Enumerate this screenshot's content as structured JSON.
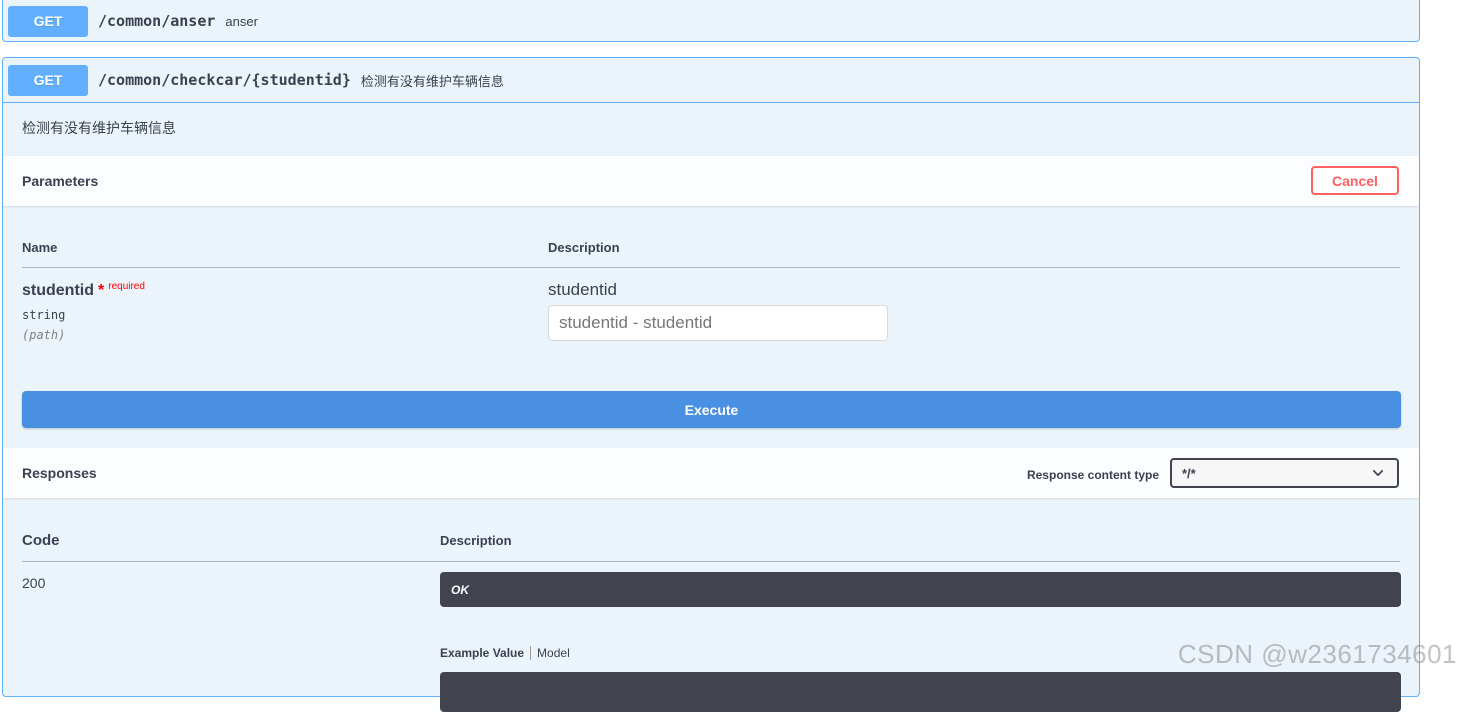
{
  "operations": [
    {
      "method": "GET",
      "path": "/common/anser",
      "summary": "anser"
    },
    {
      "method": "GET",
      "path": "/common/checkcar/{studentid}",
      "summary": "检测有没有维护车辆信息",
      "description": "检测有没有维护车辆信息",
      "parameters": {
        "title": "Parameters",
        "cancel_label": "Cancel",
        "col_name": "Name",
        "col_description": "Description",
        "param": {
          "name": "studentid",
          "required_star": "*",
          "required_label": "required",
          "type": "string",
          "in": "(path)",
          "description": "studentid",
          "placeholder": "studentid - studentid"
        }
      },
      "execute_label": "Execute",
      "responses": {
        "title": "Responses",
        "content_type_label": "Response content type",
        "content_type_value": "*/*",
        "col_code": "Code",
        "col_description": "Description",
        "rows": [
          {
            "code": "200",
            "description": "OK"
          }
        ],
        "example_tab": "Example Value",
        "model_tab": "Model"
      }
    }
  ],
  "watermark": "CSDN @w2361734601",
  "colors": {
    "get_method": "#61affe",
    "execute": "#4990e2",
    "cancel": "#ff6060",
    "dark_box": "#41444e"
  },
  "icons": {
    "select_chevron": "chevron-down-icon"
  }
}
